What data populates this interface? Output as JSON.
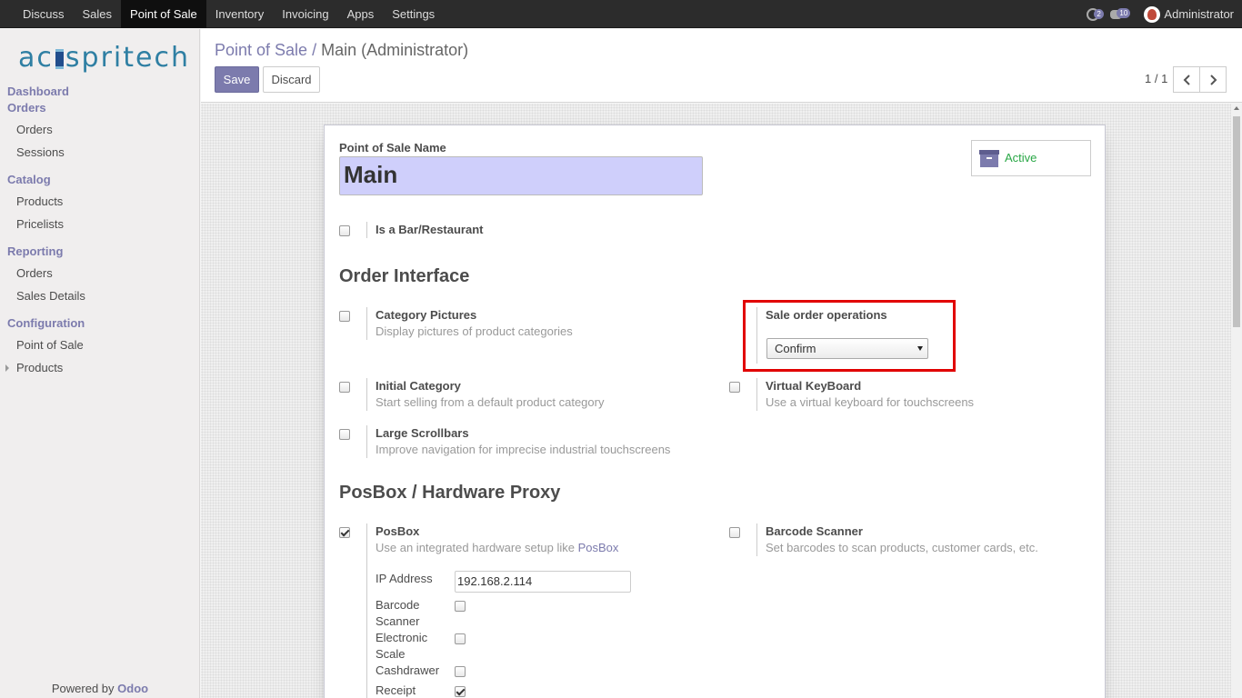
{
  "topbar": {
    "menu": [
      "Discuss",
      "Sales",
      "Point of Sale",
      "Inventory",
      "Invoicing",
      "Apps",
      "Settings"
    ],
    "active_menu": "Point of Sale",
    "activity_count": "2",
    "messages_count": "10",
    "user": "Administrator"
  },
  "sidebar": {
    "logo": {
      "pre": "ac",
      "post": "spritech"
    },
    "dashboard": "Dashboard",
    "orders_section": "Orders",
    "orders_items": [
      "Orders",
      "Sessions"
    ],
    "catalog_section": "Catalog",
    "catalog_items": [
      "Products",
      "Pricelists"
    ],
    "reporting_section": "Reporting",
    "reporting_items": [
      "Orders",
      "Sales Details"
    ],
    "configuration_section": "Configuration",
    "configuration_items": [
      "Point of Sale",
      "Products"
    ],
    "powered_by": "Powered by",
    "powered_brand": "Odoo"
  },
  "control_panel": {
    "breadcrumb_parent": "Point of Sale /",
    "breadcrumb_current": "Main (Administrator)",
    "save_label": "Save",
    "discard_label": "Discard",
    "pager": "1 / 1"
  },
  "form": {
    "name_label": "Point of Sale Name",
    "name_value": "Main",
    "active_label": "Active",
    "is_bar_label": "Is a Bar/Restaurant",
    "order_interface_title": "Order Interface",
    "category_pictures": {
      "label": "Category Pictures",
      "desc": "Display pictures of product categories",
      "checked": false
    },
    "sale_order_ops": {
      "label": "Sale order operations",
      "value": "Confirm"
    },
    "initial_category": {
      "label": "Initial Category",
      "desc": "Start selling from a default product category",
      "checked": false
    },
    "virtual_keyboard": {
      "label": "Virtual KeyBoard",
      "desc": "Use a virtual keyboard for touchscreens",
      "checked": false
    },
    "large_scrollbars": {
      "label": "Large Scrollbars",
      "desc": "Improve navigation for imprecise industrial touchscreens",
      "checked": false
    },
    "posbox_title": "PosBox / Hardware Proxy",
    "posbox": {
      "label": "PosBox",
      "desc": "Use an integrated hardware setup like",
      "desc_link": "PosBox",
      "checked": true
    },
    "barcode_scanner": {
      "label": "Barcode Scanner",
      "desc": "Set barcodes to scan products, customer cards, etc.",
      "checked": false
    },
    "ip_address_label": "IP Address",
    "ip_address_value": "192.168.2.114",
    "hw_barcode_label_1": "Barcode",
    "hw_barcode_label_2": "Scanner",
    "hw_scale_label_1": "Electronic",
    "hw_scale_label_2": "Scale",
    "hw_cashdrawer_label": "Cashdrawer",
    "hw_receipt_label": "Receipt"
  }
}
